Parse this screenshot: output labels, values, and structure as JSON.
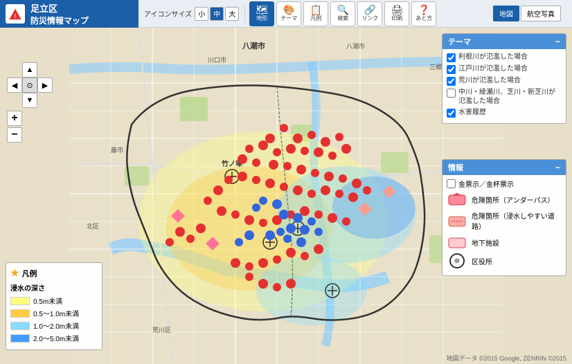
{
  "header": {
    "title": "足立区",
    "subtitle": "防災情報マップ",
    "icon": "🔺"
  },
  "toolbar": {
    "icon_size_label": "アイコンサイズ",
    "sizes": [
      "小",
      "中",
      "大"
    ],
    "active_size": 1,
    "buttons": [
      {
        "label": "地形",
        "icon": "🗺"
      },
      {
        "label": "テーマ",
        "icon": "🎨"
      },
      {
        "label": "凡例",
        "icon": "📋"
      },
      {
        "label": "検索",
        "icon": "🔍"
      },
      {
        "label": "リンク",
        "icon": "🔗"
      },
      {
        "label": "印刷",
        "icon": "🖨"
      },
      {
        "label": "あと方",
        "icon": "❓"
      }
    ],
    "map_types": [
      "地図",
      "航空写真"
    ],
    "active_map": 0
  },
  "theme_panel": {
    "title": "テーマ",
    "items": [
      {
        "checked": true,
        "label": "利根川が氾濫した場合"
      },
      {
        "checked": true,
        "label": "江戸川が氾濫した場合"
      },
      {
        "checked": true,
        "label": "荒川が氾濫した場合"
      },
      {
        "checked": false,
        "label": "中川・綾瀬川、芝川・新芝川が氾濫した場合"
      },
      {
        "checked": true,
        "label": "水害履歴"
      }
    ]
  },
  "legend2_panel": {
    "title": "情報",
    "gold_check_label": "金票示／金杯票示",
    "items": [
      {
        "label": "危険箇所（アンダーパス）"
      },
      {
        "label": "危険箇所（浸水しやすい道路）"
      },
      {
        "label": "地下施設"
      },
      {
        "label": "区役所"
      }
    ]
  },
  "legend_panel": {
    "title": "凡例",
    "depth_label": "浸水の深さ",
    "items": [
      {
        "color": "#ffff80",
        "label": "0.5m未満"
      },
      {
        "color": "#ffcc44",
        "label": "0.5～1.0m未満"
      },
      {
        "color": "#88ddff",
        "label": "1.0～2.0m未満"
      },
      {
        "color": "#4499ff",
        "label": "2.0～5.0m未満"
      }
    ]
  },
  "attribution": "地図データ ©2015 Google, ZENRIN ©2015"
}
